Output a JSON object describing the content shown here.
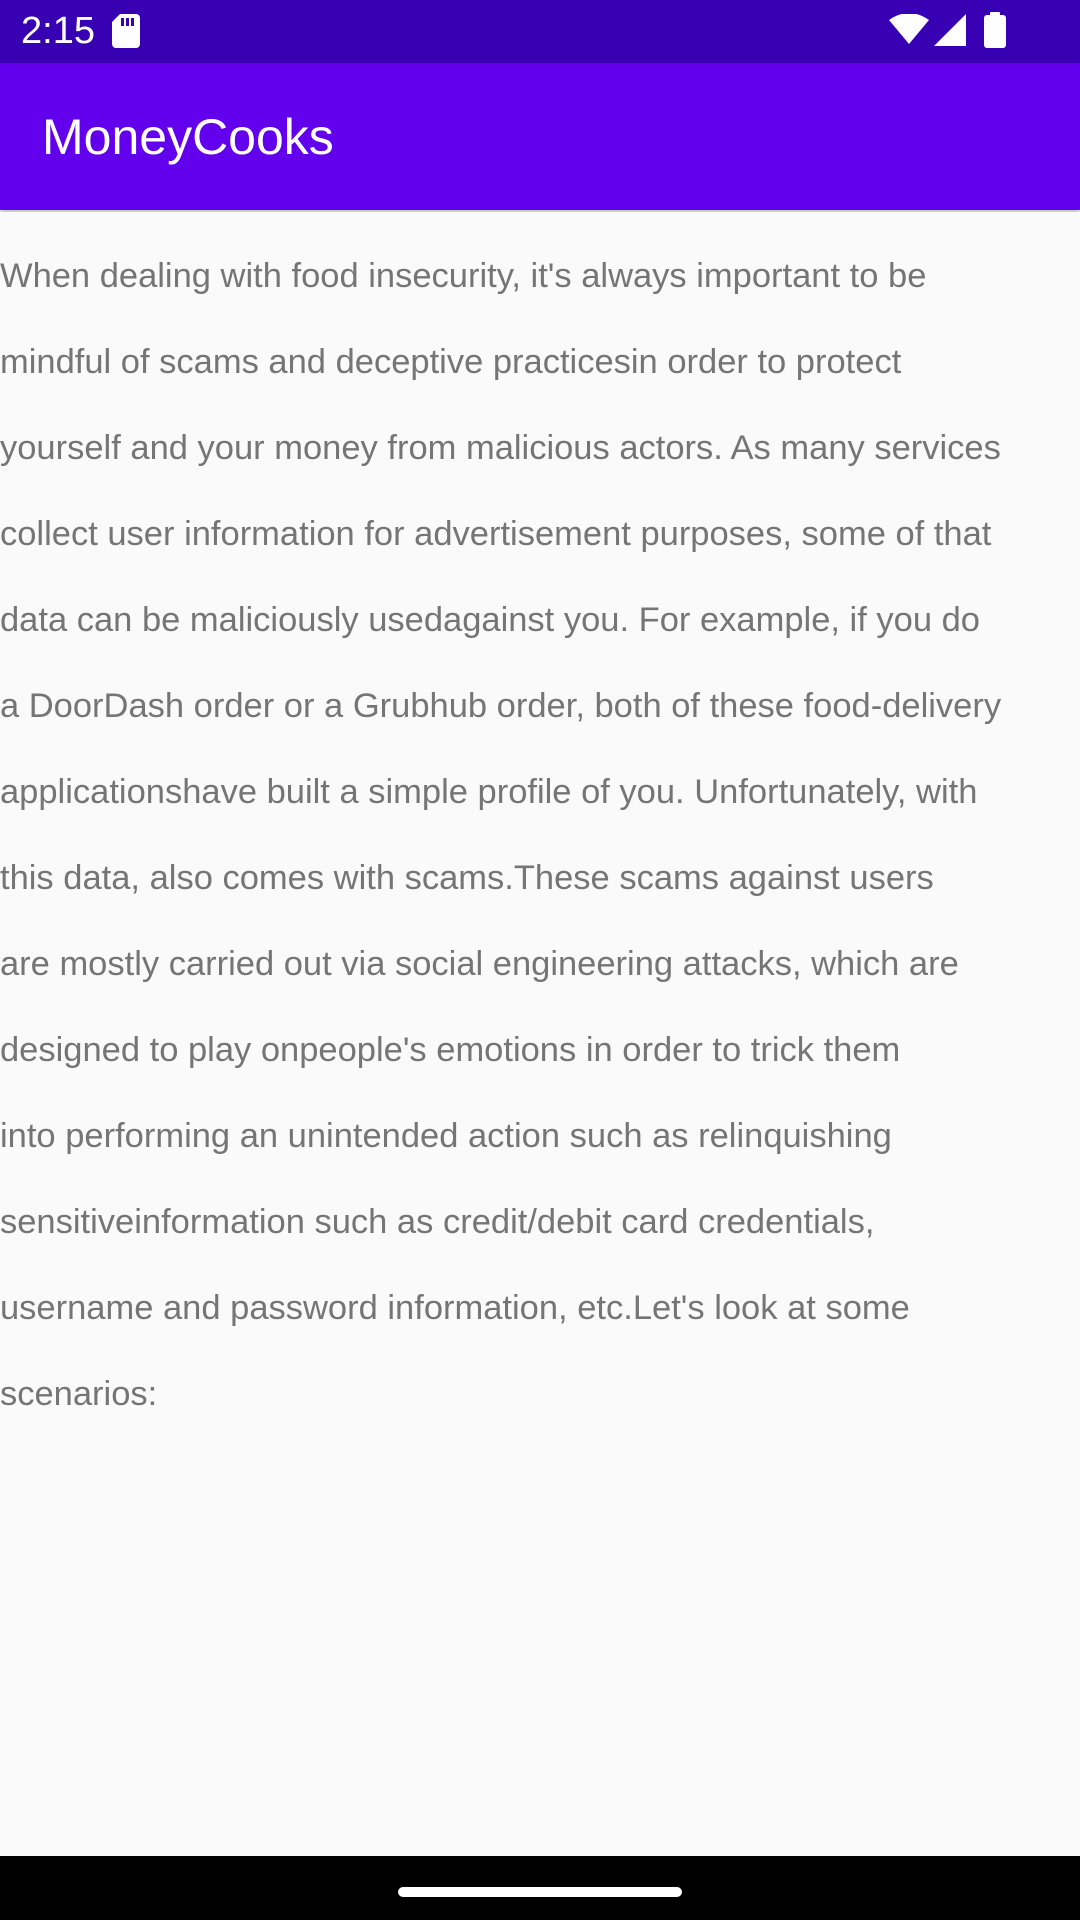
{
  "status_bar": {
    "time": "2:15",
    "icons": [
      "sd-card-icon",
      "wifi-icon",
      "cell-signal-icon",
      "battery-icon"
    ]
  },
  "app_bar": {
    "title": "MoneyCooks",
    "color": "#6200ee",
    "status_color": "#3700b3"
  },
  "content": {
    "text_lines": [
      "When dealing with food insecurity, it's always important to be",
      "mindful of scams and deceptive practicesin order to protect",
      "yourself and your money from malicious actors. As many services",
      "collect user information for advertisement purposes, some of that",
      "data can be maliciously usedagainst you. For example, if you do",
      "a DoorDash order or a Grubhub order, both of these food-delivery",
      "applicationshave built a simple profile of you. Unfortunately, with",
      "this data, also comes with scams.These scams against users",
      "are mostly carried out via social engineering attacks, which are",
      "designed to play onpeople's emotions in order to trick them",
      "into performing an unintended action such as relinquishing",
      "sensitiveinformation such as credit/debit card credentials,",
      "username and password information, etc.Let's look at some",
      "scenarios:"
    ]
  },
  "nav_bar": {
    "handle": "home-gesture-handle"
  }
}
